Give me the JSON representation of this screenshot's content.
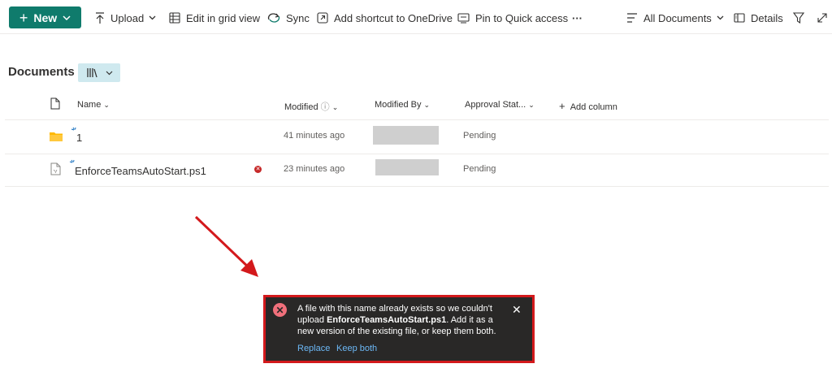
{
  "toolbar": {
    "new_label": "New",
    "upload_label": "Upload",
    "grid_label": "Edit in grid view",
    "sync_label": "Sync",
    "shortcut_label": "Add shortcut to OneDrive",
    "pin_label": "Pin to Quick access",
    "more_label": "···",
    "view_label": "All Documents",
    "details_label": "Details"
  },
  "library": {
    "title": "Documents"
  },
  "columns": {
    "name": "Name",
    "modified": "Modified",
    "modified_by": "Modified By",
    "approval": "Approval Stat...",
    "add": "Add column"
  },
  "rows": [
    {
      "name": "1",
      "type": "folder",
      "modified": "41 minutes ago",
      "approval": "Pending"
    },
    {
      "name": "EnforceTeamsAutoStart.ps1",
      "type": "file",
      "modified": "23 minutes ago",
      "approval": "Pending"
    }
  ],
  "toast": {
    "msg_before": "A file with this name already exists so we couldn't upload ",
    "filename": "EnforceTeamsAutoStart.ps1",
    "msg_after": ". Add it as a new version of the existing file, or keep them both.",
    "replace_label": "Replace",
    "keep_label": "Keep both"
  },
  "colors": {
    "accent": "#0f7b6c",
    "toast_bg": "#292827",
    "link": "#6cb8f6",
    "highlight": "#d3191c"
  }
}
